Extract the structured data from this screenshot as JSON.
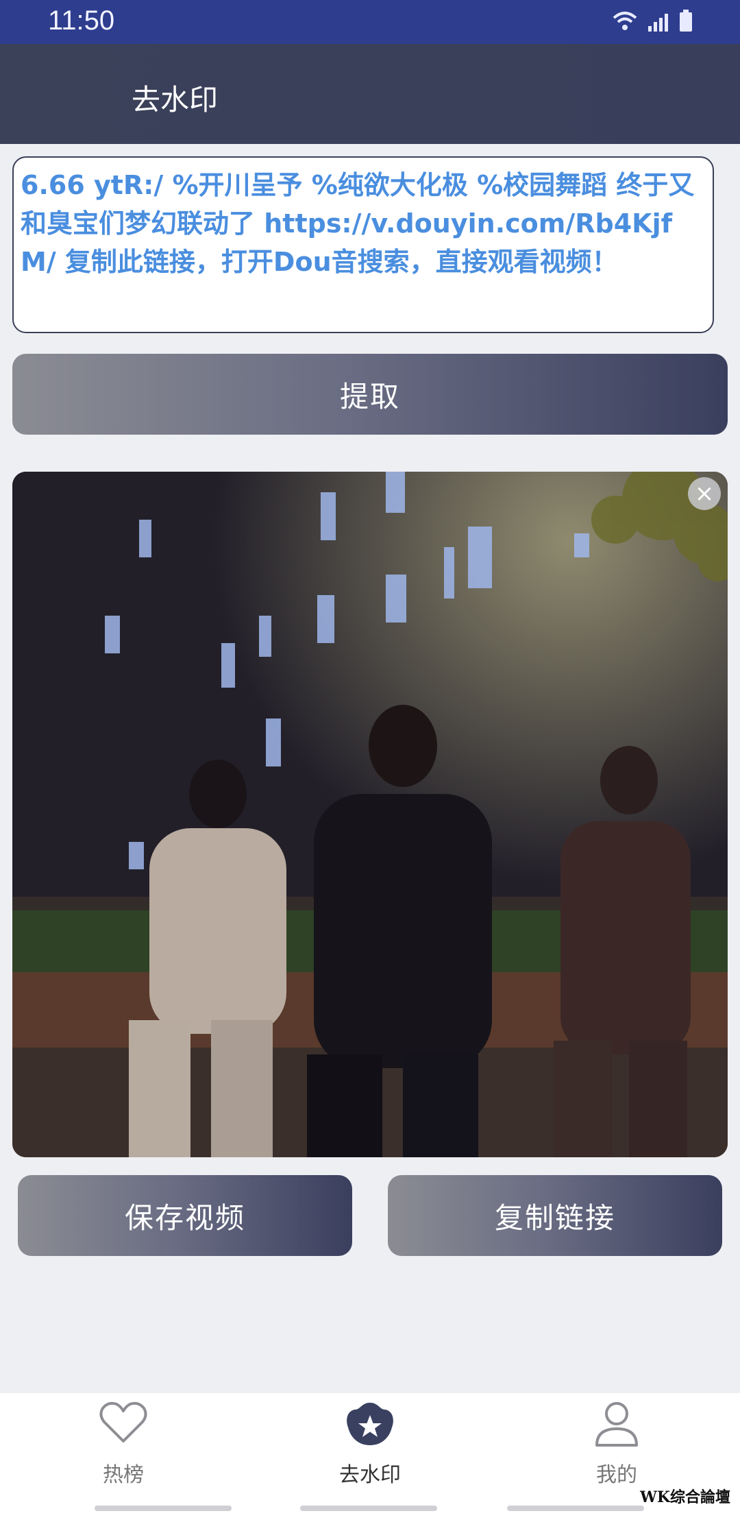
{
  "status_bar": {
    "time": "11:50",
    "icons": [
      "wifi-icon",
      "signal-icon",
      "battery-icon"
    ]
  },
  "header": {
    "title": "去水印"
  },
  "link_input": {
    "text": "6.66 ytR:/ %开川呈予 %纯欲大化极 %校园舞蹈 终于又和臭宝们梦幻联动了 https://v.douyin.com/Rb4KjfM/ 复制此链接，打开Dou音搜索，直接观看视频！"
  },
  "actions": {
    "extract_label": "提取",
    "save_video_label": "保存视频",
    "copy_link_label": "复制链接"
  },
  "video_preview": {
    "close_icon": "close-icon"
  },
  "bottom_nav": {
    "items": [
      {
        "label": "热榜",
        "icon": "heart-icon"
      },
      {
        "label": "去水印",
        "icon": "star-badge-icon",
        "active": true
      },
      {
        "label": "我的",
        "icon": "user-icon"
      }
    ]
  },
  "watermark": {
    "text": "WK综合論壇"
  },
  "colors": {
    "status_bar": "#2f3d8f",
    "header": "#3b4159",
    "link_text": "#4a8edf",
    "background": "#eeeff3"
  }
}
